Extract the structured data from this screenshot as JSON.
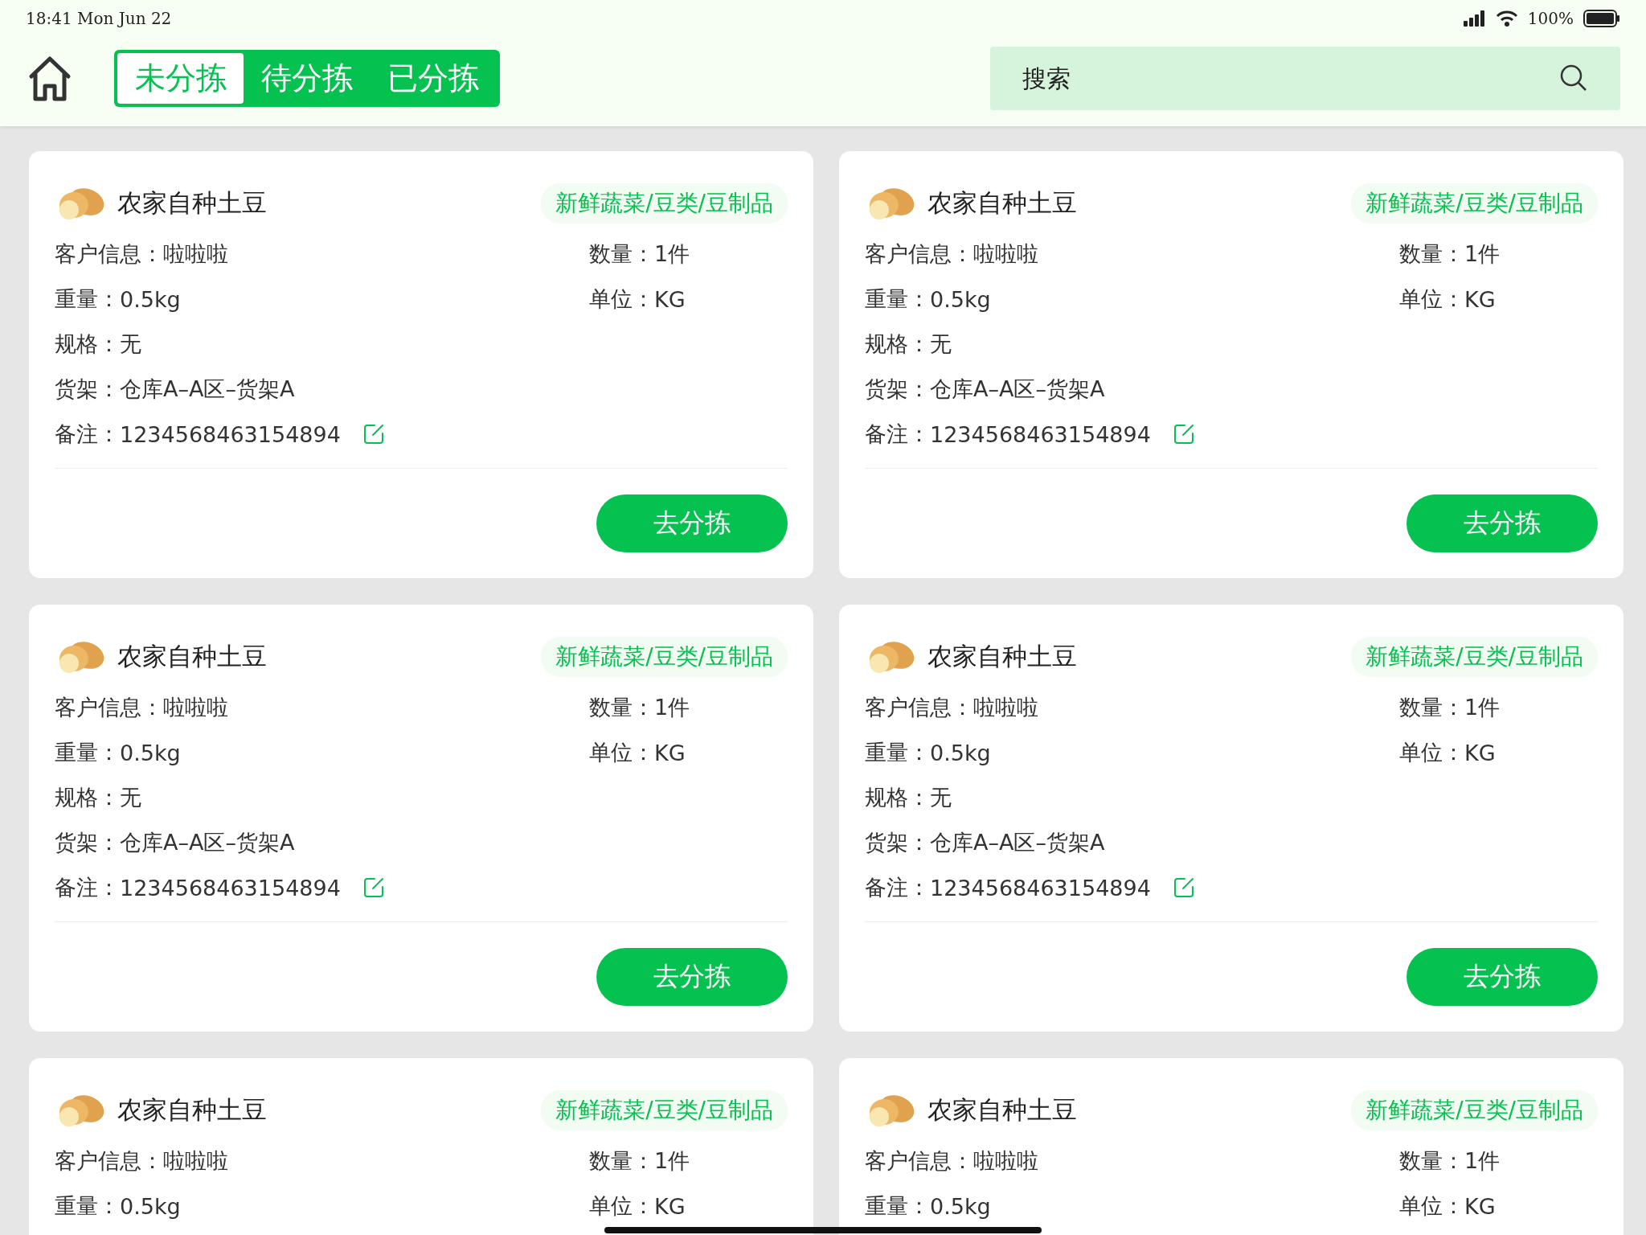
{
  "status_bar": {
    "time": "18:41 Mon Jun 22",
    "battery": "100%"
  },
  "tabs": [
    {
      "label": "未分拣",
      "selected": true
    },
    {
      "label": "待分拣",
      "selected": false
    },
    {
      "label": "已分拣",
      "selected": false
    }
  ],
  "search": {
    "placeholder": "搜索"
  },
  "cards": [
    {
      "title": "农家自种土豆",
      "category": "新鲜蔬菜/豆类/豆制品",
      "rows": [
        {
          "kind": "info",
          "label": "客户信息：",
          "value": "啦啦啦",
          "right_label": "数量：",
          "right_value": "1件"
        },
        {
          "kind": "info",
          "label": "重量：",
          "value": "0.5kg",
          "right_label": "单位：",
          "right_value": "KG"
        },
        {
          "kind": "info",
          "label": "规格：",
          "value": "无"
        },
        {
          "kind": "info",
          "label": "货架：",
          "value": "仓库A–A区–货架A"
        },
        {
          "kind": "note",
          "label": "备注：",
          "value": "1234568463154894"
        }
      ],
      "button": "去分拣"
    },
    {
      "title": "农家自种土豆",
      "category": "新鲜蔬菜/豆类/豆制品",
      "rows": [
        {
          "kind": "info",
          "label": "客户信息：",
          "value": "啦啦啦",
          "right_label": "数量：",
          "right_value": "1件"
        },
        {
          "kind": "info",
          "label": "重量：",
          "value": "0.5kg",
          "right_label": "单位：",
          "right_value": "KG"
        },
        {
          "kind": "info",
          "label": "规格：",
          "value": "无"
        },
        {
          "kind": "info",
          "label": "货架：",
          "value": "仓库A–A区–货架A"
        },
        {
          "kind": "note",
          "label": "备注：",
          "value": "1234568463154894"
        }
      ],
      "button": "去分拣"
    },
    {
      "title": "农家自种土豆",
      "category": "新鲜蔬菜/豆类/豆制品",
      "rows": [
        {
          "kind": "info",
          "label": "客户信息：",
          "value": "啦啦啦",
          "right_label": "数量：",
          "right_value": "1件"
        },
        {
          "kind": "info",
          "label": "重量：",
          "value": "0.5kg",
          "right_label": "单位：",
          "right_value": "KG"
        },
        {
          "kind": "info",
          "label": "规格：",
          "value": "无"
        },
        {
          "kind": "info",
          "label": "货架：",
          "value": "仓库A–A区–货架A"
        },
        {
          "kind": "note",
          "label": "备注：",
          "value": "1234568463154894"
        }
      ],
      "button": "去分拣"
    },
    {
      "title": "农家自种土豆",
      "category": "新鲜蔬菜/豆类/豆制品",
      "rows": [
        {
          "kind": "info",
          "label": "客户信息：",
          "value": "啦啦啦",
          "right_label": "数量：",
          "right_value": "1件"
        },
        {
          "kind": "info",
          "label": "重量：",
          "value": "0.5kg",
          "right_label": "单位：",
          "right_value": "KG"
        },
        {
          "kind": "info",
          "label": "规格：",
          "value": "无"
        },
        {
          "kind": "info",
          "label": "货架：",
          "value": "仓库A–A区–货架A"
        },
        {
          "kind": "note",
          "label": "备注：",
          "value": "1234568463154894"
        }
      ],
      "button": "去分拣"
    },
    {
      "title": "农家自种土豆",
      "category": "新鲜蔬菜/豆类/豆制品",
      "rows": [
        {
          "kind": "info",
          "label": "客户信息：",
          "value": "啦啦啦",
          "right_label": "数量：",
          "right_value": "1件"
        },
        {
          "kind": "info",
          "label": "重量：",
          "value": "0.5kg",
          "right_label": "单位：",
          "right_value": "KG"
        }
      ]
    },
    {
      "title": "农家自种土豆",
      "category": "新鲜蔬菜/豆类/豆制品",
      "rows": [
        {
          "kind": "info",
          "label": "客户信息：",
          "value": "啦啦啦",
          "right_label": "数量：",
          "right_value": "1件"
        },
        {
          "kind": "info",
          "label": "重量：",
          "value": "0.5kg",
          "right_label": "单位：",
          "right_value": "KG"
        }
      ]
    }
  ]
}
